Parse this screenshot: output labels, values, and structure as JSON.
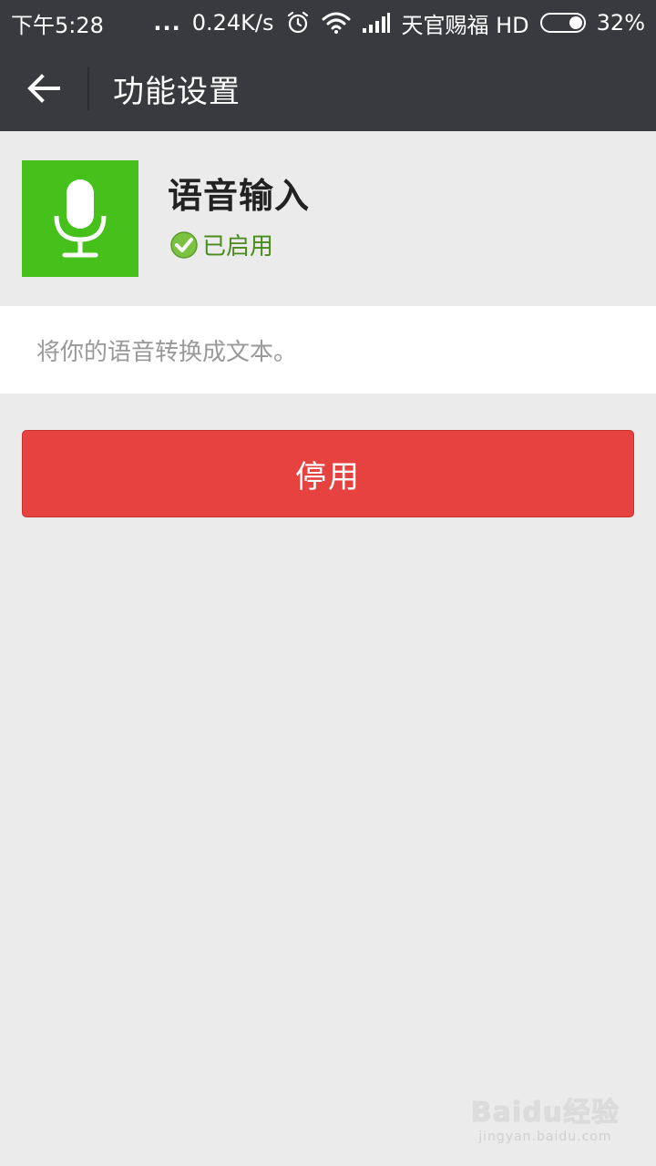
{
  "status_bar": {
    "time": "下午5:28",
    "dots": "...",
    "speed": "0.24K/s",
    "carrier": "天官赐福 HD",
    "battery_percent": "32%",
    "battery_level": 0.32
  },
  "titlebar": {
    "title": "功能设置"
  },
  "feature": {
    "name": "语音输入",
    "status": "已启用",
    "description": "将你的语音转换成文本。"
  },
  "actions": {
    "disable_label": "停用"
  },
  "colors": {
    "bar_bg": "#393a3f",
    "feature_icon_bg": "#46c01b",
    "status_text": "#4a8b1c",
    "disable_button_bg": "#e64340",
    "page_bg": "#ebebeb"
  },
  "watermark": {
    "logo": "Baidu经验",
    "url": "jingyan.baidu.com"
  }
}
